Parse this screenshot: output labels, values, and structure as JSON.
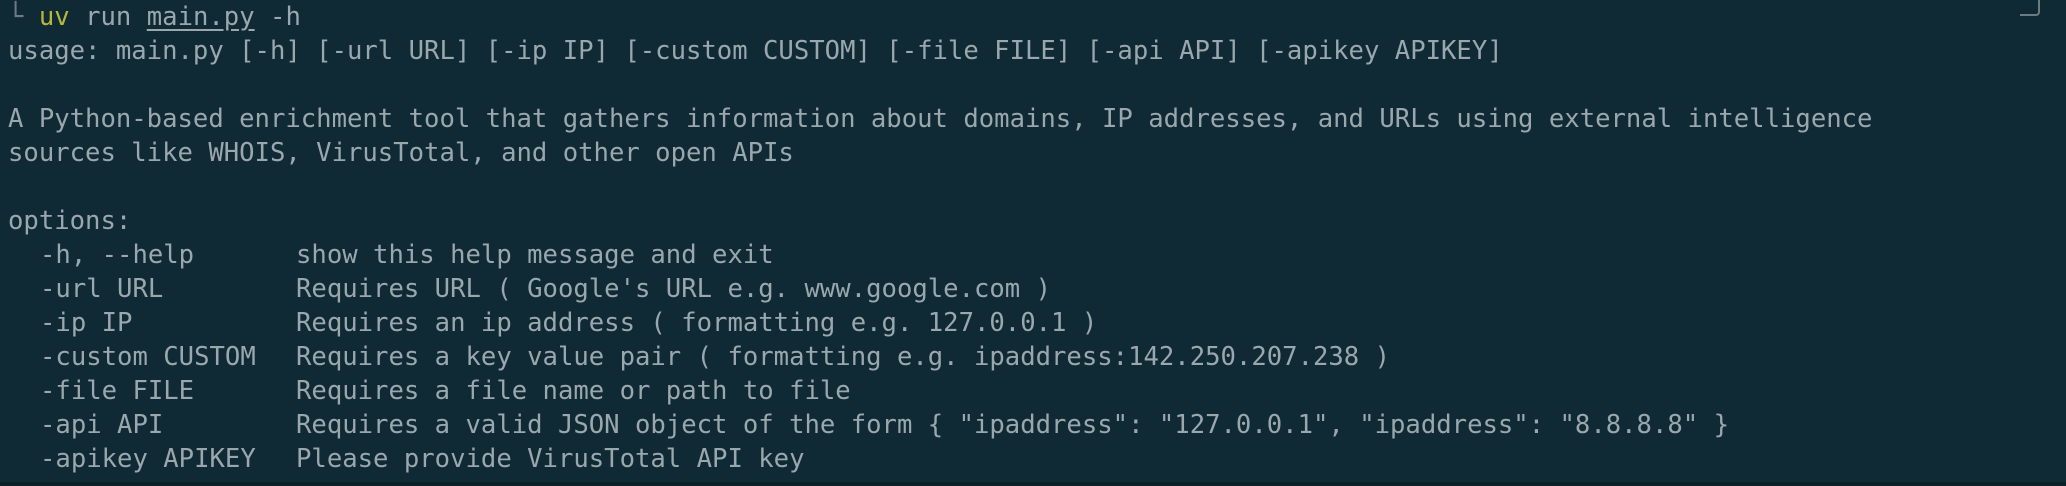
{
  "prompt": {
    "tree_glyph": "└",
    "command": "uv",
    "subcommand": "run",
    "script": "main.py",
    "flag": "-h"
  },
  "usage_line": "usage: main.py [-h] [-url URL] [-ip IP] [-custom CUSTOM] [-file FILE] [-api API] [-apikey APIKEY]",
  "description_lines": [
    "A Python-based enrichment tool that gathers information about domains, IP addresses, and URLs using external intelligence",
    "sources like WHOIS, VirusTotal, and other open APIs"
  ],
  "options_header": "options:",
  "options": [
    {
      "flag": "-h, --help",
      "desc": "show this help message and exit"
    },
    {
      "flag": "-url URL",
      "desc": "Requires URL ( Google's URL e.g. www.google.com )"
    },
    {
      "flag": "-ip IP",
      "desc": "Requires an ip address ( formatting e.g. 127.0.0.1 )"
    },
    {
      "flag": "-custom CUSTOM",
      "desc": "Requires a key value pair ( formatting e.g. ipaddress:142.250.207.238 )"
    },
    {
      "flag": "-file FILE",
      "desc": "Requires a file name or path to file"
    },
    {
      "flag": "-api API",
      "desc": "Requires a valid JSON object of the form { \"ipaddress\": \"127.0.0.1\", \"ipaddress\": \"8.8.8.8\" }"
    },
    {
      "flag": "-apikey APIKEY",
      "desc": "Please provide VirusTotal API key"
    }
  ],
  "colors": {
    "background": "#0f2a35",
    "text": "#9aa7ad",
    "command": "#b5b83a"
  }
}
